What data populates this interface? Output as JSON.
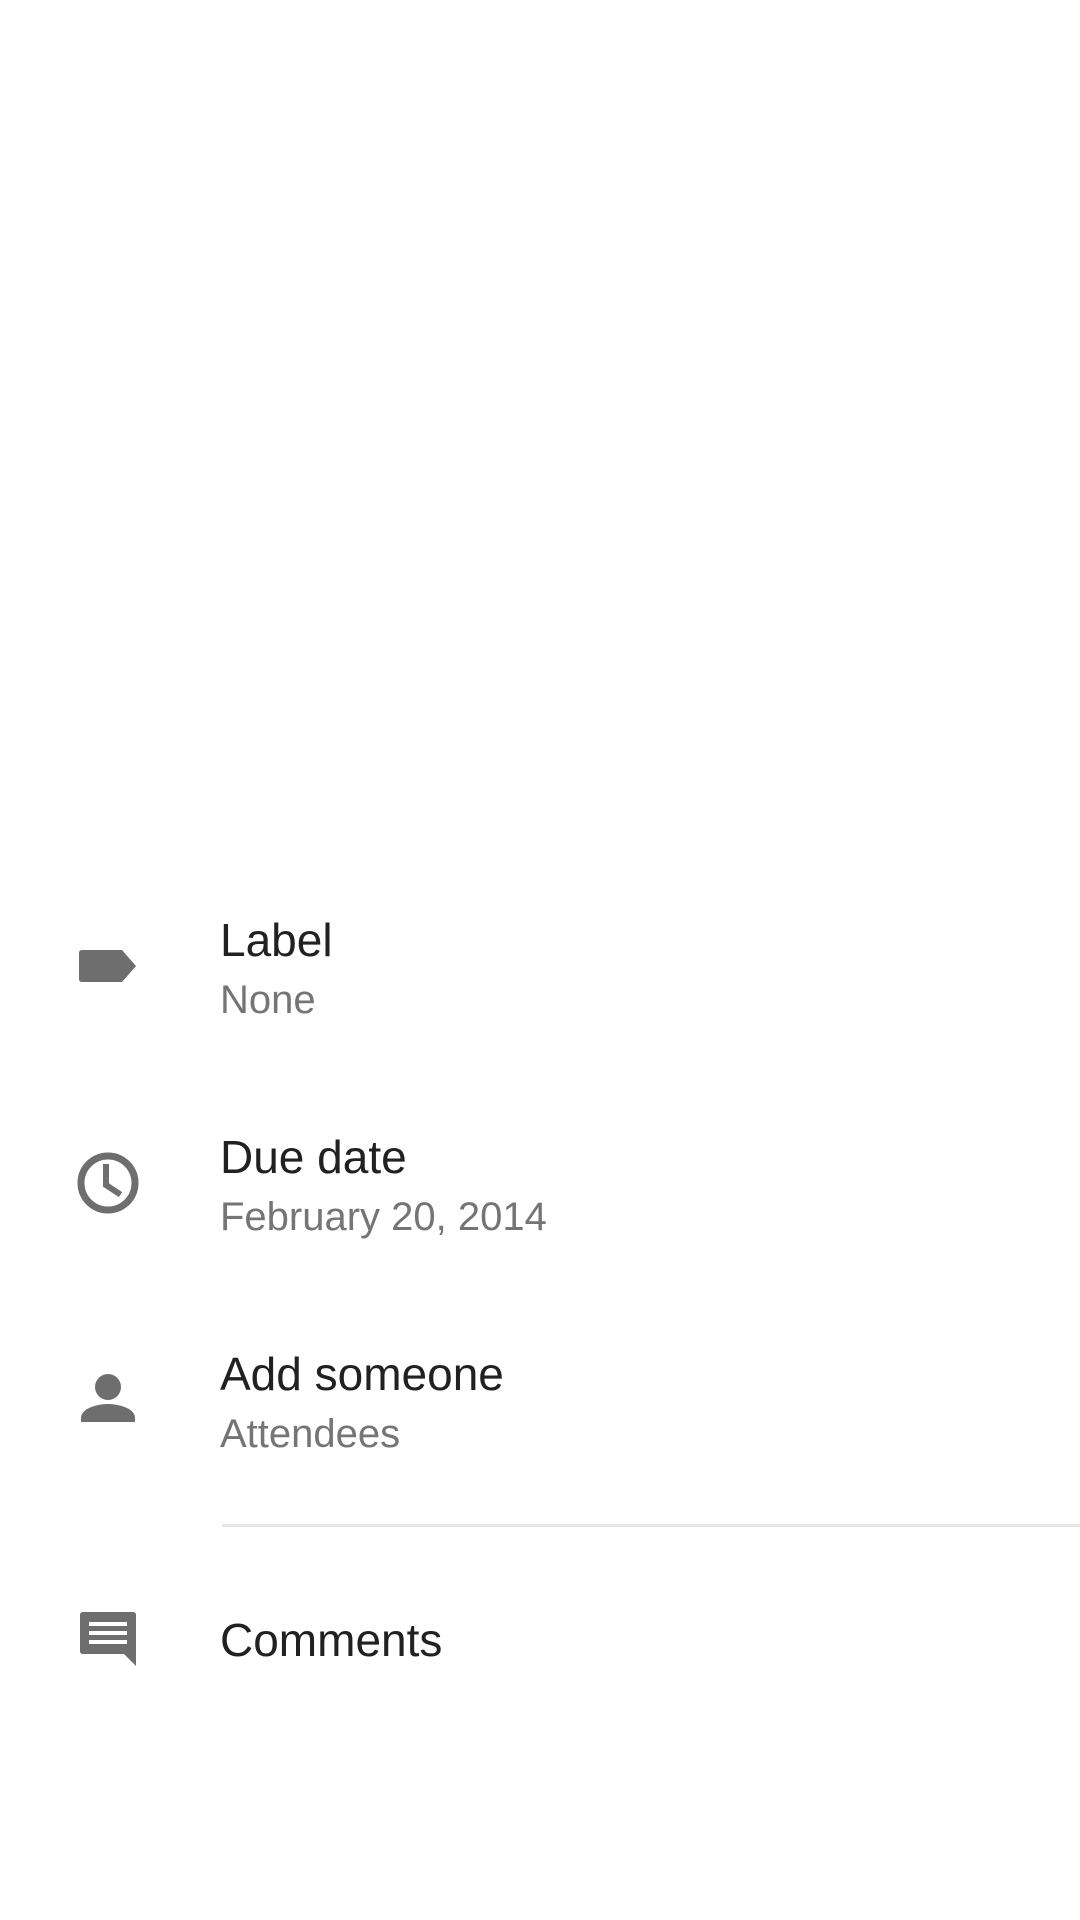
{
  "details": {
    "label": {
      "icon": "label-icon",
      "title": "Label",
      "value": "None"
    },
    "due_date": {
      "icon": "clock-icon",
      "title": "Due date",
      "value": "February 20, 2014"
    },
    "people": {
      "icon": "person-icon",
      "title": "Add someone",
      "value": "Attendees"
    },
    "comments": {
      "icon": "comment-icon",
      "title": "Comments"
    }
  },
  "colors": {
    "icon": "#6e6e6e",
    "title": "#212121",
    "subtitle": "#757575",
    "divider": "#e6e6e6"
  }
}
